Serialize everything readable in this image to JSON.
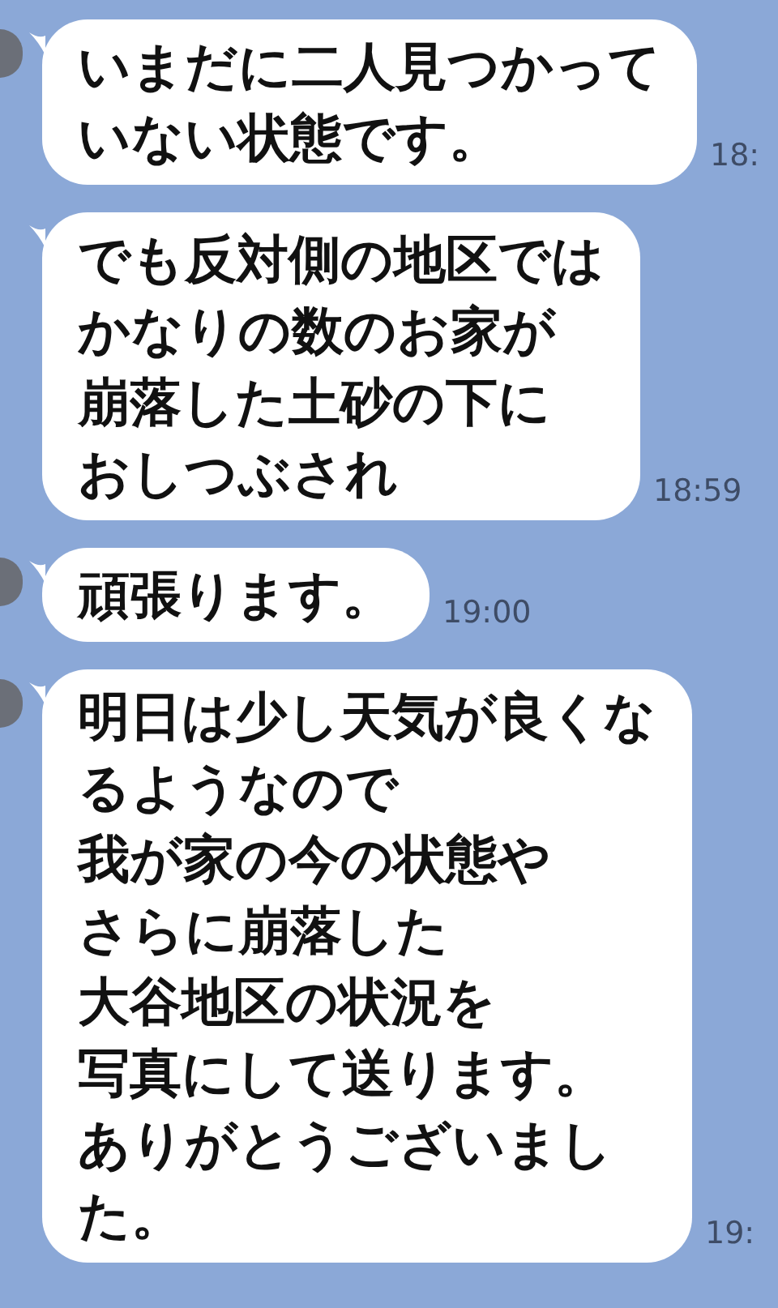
{
  "messages": [
    {
      "lines": [
        "いまだに二人見つかって",
        "いない状態です。"
      ],
      "time": "18:",
      "show_avatar": true
    },
    {
      "lines": [
        "でも反対側の地区では",
        "かなりの数のお家が",
        "崩落した土砂の下に",
        "おしつぶされ"
      ],
      "time": "18:59",
      "show_avatar": false
    },
    {
      "lines": [
        "頑張ります。"
      ],
      "time": "19:00",
      "show_avatar": true
    },
    {
      "lines": [
        "明日は少し天気が良くな",
        "るようなので",
        "我が家の今の状態や",
        "さらに崩落した",
        "大谷地区の状況を",
        "写真にして送ります。",
        "ありがとうございまし",
        "た。"
      ],
      "time": "19:",
      "show_avatar": true
    }
  ]
}
